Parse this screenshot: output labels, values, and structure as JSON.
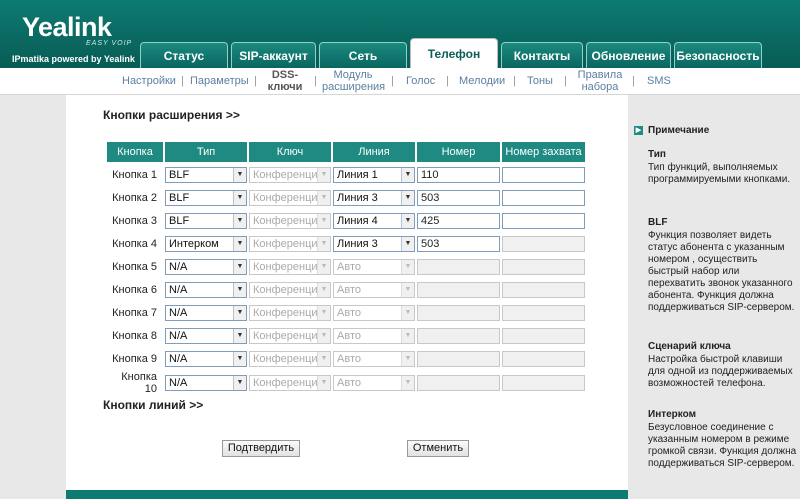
{
  "brand": {
    "logo": "Yealink",
    "tagline": "EASY VOIP",
    "powered": "IPmatika powered by Yealink"
  },
  "tabs": [
    {
      "label": "Статус",
      "active": false
    },
    {
      "label": "SIP-аккаунт",
      "active": false
    },
    {
      "label": "Сеть",
      "active": false
    },
    {
      "label": "Телефон",
      "active": true
    },
    {
      "label": "Контакты",
      "active": false
    },
    {
      "label": "Обновление",
      "active": false
    },
    {
      "label": "Безопасность",
      "active": false
    }
  ],
  "subnav": {
    "settings": "Настройки",
    "params": "Параметры",
    "dss_1": "DSS-",
    "dss_2": "ключи",
    "module_1": "Модуль",
    "module_2": "расширения",
    "voice": "Голос",
    "melodies": "Мелодии",
    "tones": "Тоны",
    "rules_1": "Правила",
    "rules_2": "набора",
    "sms": "SMS"
  },
  "section": {
    "title": "Кнопки расширения >>",
    "lines_title": "Кнопки линий >>"
  },
  "table": {
    "headers": {
      "key": "Кнопка",
      "type": "Тип",
      "value": "Ключ",
      "line": "Линия",
      "number": "Номер",
      "pickup": "Номер захвата"
    },
    "rows": [
      {
        "label": "Кнопка 1",
        "type": "BLF",
        "value": "Конференци",
        "line": "Линия 1",
        "number": "110",
        "pickup": ""
      },
      {
        "label": "Кнопка 2",
        "type": "BLF",
        "value": "Конференци",
        "line": "Линия 3",
        "number": "503",
        "pickup": ""
      },
      {
        "label": "Кнопка 3",
        "type": "BLF",
        "value": "Конференци",
        "line": "Линия 4",
        "number": "425",
        "pickup": ""
      },
      {
        "label": "Кнопка 4",
        "type": "Интерком",
        "value": "Конференци",
        "line": "Линия 3",
        "number": "503",
        "pickup": ""
      },
      {
        "label": "Кнопка 5",
        "type": "N/A",
        "value": "Конференци",
        "line": "Авто",
        "number": "",
        "pickup": ""
      },
      {
        "label": "Кнопка 6",
        "type": "N/A",
        "value": "Конференци",
        "line": "Авто",
        "number": "",
        "pickup": ""
      },
      {
        "label": "Кнопка 7",
        "type": "N/A",
        "value": "Конференци",
        "line": "Авто",
        "number": "",
        "pickup": ""
      },
      {
        "label": "Кнопка 8",
        "type": "N/A",
        "value": "Конференци",
        "line": "Авто",
        "number": "",
        "pickup": ""
      },
      {
        "label": "Кнопка 9",
        "type": "N/A",
        "value": "Конференци",
        "line": "Авто",
        "number": "",
        "pickup": ""
      },
      {
        "label": "Кнопка 10",
        "type": "N/A",
        "value": "Конференци",
        "line": "Авто",
        "number": "",
        "pickup": ""
      }
    ]
  },
  "buttons": {
    "confirm": "Подтвердить",
    "cancel": "Отменить"
  },
  "sidebar": {
    "title": "Примечание",
    "type_title": "Тип",
    "type_text": "Тип функций, выполняемых программируемыми кнопками.",
    "blf_title": "BLF",
    "blf_text": "Функция позволяет видеть статус абонента с указанным номером , осуществить быстрый набор или перехватить звонок указанного абонента. Функция должна поддерживаться SIP-сервером.",
    "speed_title": "Сценарий ключа",
    "speed_text": "Настройка быстрой клавиши для одной из поддерживаемых возможностей телефона.",
    "intercom_title": "Интерком",
    "intercom_text": "Безусловное соединение с указанным номером в режиме громкой связи. Функция должна поддерживаться SIP-сервером."
  },
  "colors": {
    "header": "#0d7b72",
    "table_header": "#1e8a82",
    "link": "#5a7fa3"
  }
}
